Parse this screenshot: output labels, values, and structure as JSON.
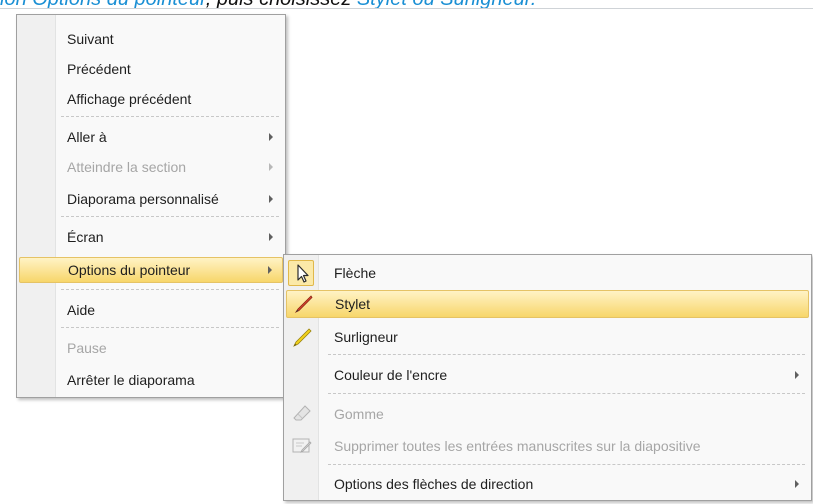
{
  "header": {
    "part1": "ion Options du pointeur",
    "part2": ", puis choisissez",
    "part3": "Stylet ou Surligneur."
  },
  "context_menu": {
    "items": [
      {
        "label": "Suivant",
        "enabled": true
      },
      {
        "label": "Précédent",
        "enabled": true
      },
      {
        "label": "Affichage précédent",
        "enabled": true
      },
      {
        "label": "Aller à",
        "enabled": true,
        "submenu": true
      },
      {
        "label": "Atteindre la section",
        "enabled": false,
        "submenu": true
      },
      {
        "label": "Diaporama personnalisé",
        "enabled": true,
        "submenu": true
      },
      {
        "label": "Écran",
        "enabled": true,
        "submenu": true
      },
      {
        "label": "Options du pointeur",
        "enabled": true,
        "submenu": true,
        "highlighted": true
      },
      {
        "label": "Aide",
        "enabled": true
      },
      {
        "label": "Pause",
        "enabled": false
      },
      {
        "label": "Arrêter le diaporama",
        "enabled": true
      }
    ]
  },
  "pointer_submenu": {
    "items": [
      {
        "label": "Flèche",
        "icon": "arrow-cursor-icon",
        "enabled": true,
        "checked": true
      },
      {
        "label": "Stylet",
        "icon": "pen-icon",
        "enabled": true,
        "highlighted": true
      },
      {
        "label": "Surligneur",
        "icon": "highlighter-icon",
        "enabled": true
      },
      {
        "label": "Couleur de l'encre",
        "enabled": true,
        "submenu": true
      },
      {
        "label": "Gomme",
        "icon": "eraser-icon",
        "enabled": false
      },
      {
        "label": "Supprimer toutes les entrées manuscrites sur la diapositive",
        "icon": "erase-all-icon",
        "enabled": false
      },
      {
        "label": "Options des flèches de direction",
        "enabled": true,
        "submenu": true
      }
    ]
  },
  "colors": {
    "highlight": "#fbe394",
    "highlight_border": "#e5c365",
    "disabled_text": "#a6a6a6",
    "link_blue": "#1a8fd4"
  }
}
